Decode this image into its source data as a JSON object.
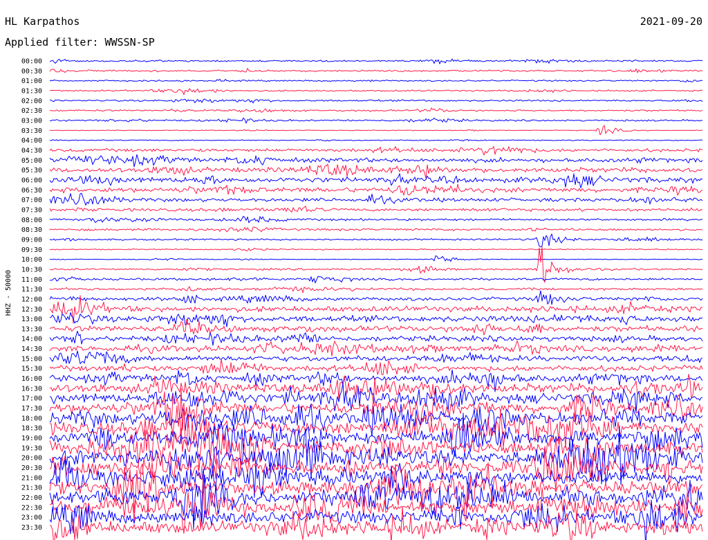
{
  "header": {
    "station": "HL Karpathos",
    "date": "2021-09-20",
    "filter": "Applied filter: WWSSN-SP"
  },
  "chart_data": {
    "type": "helicorder",
    "ylabel": "HHZ - 50000",
    "colors": [
      "#0000ff",
      "#ff1a4a"
    ],
    "row_labels": [
      "00:00",
      "00:30",
      "01:00",
      "01:30",
      "02:00",
      "02:30",
      "03:00",
      "03:30",
      "04:00",
      "04:30",
      "05:00",
      "05:30",
      "06:00",
      "06:30",
      "07:00",
      "07:30",
      "08:00",
      "08:30",
      "09:00",
      "09:30",
      "10:00",
      "10:30",
      "11:00",
      "11:30",
      "12:00",
      "12:30",
      "13:00",
      "13:30",
      "14:00",
      "14:30",
      "15:00",
      "15:30",
      "16:00",
      "16:30",
      "17:00",
      "17:30",
      "18:00",
      "18:30",
      "19:00",
      "19:30",
      "20:00",
      "20:30",
      "21:00",
      "21:30",
      "22:00",
      "22:30",
      "23:00",
      "23:30"
    ],
    "relative_noise_level": [
      0.3,
      0.3,
      0.26,
      0.26,
      0.3,
      0.3,
      0.3,
      0.12,
      0.18,
      0.55,
      0.75,
      0.85,
      0.95,
      0.85,
      0.65,
      0.5,
      0.4,
      0.4,
      0.3,
      0.2,
      0.14,
      0.32,
      0.38,
      0.4,
      0.6,
      0.95,
      1.05,
      1.0,
      0.95,
      1.0,
      0.95,
      1.0,
      1.3,
      1.6,
      1.7,
      1.9,
      2.1,
      2.2,
      2.2,
      2.4,
      2.4,
      2.4,
      2.3,
      2.3,
      2.4,
      2.4,
      2.2,
      2.1
    ],
    "notable_events": [
      {
        "row": "03:30",
        "position": 0.84,
        "strength": 2.5
      },
      {
        "row": "07:00",
        "position": 0.49,
        "strength": 3
      },
      {
        "row": "08:00",
        "position": 0.06,
        "strength": 2
      },
      {
        "row": "09:00",
        "position": 0.75,
        "strength": 4
      },
      {
        "row": "10:00",
        "position": 0.59,
        "strength": 2
      },
      {
        "row": "10:30",
        "position": 0.75,
        "strength": 9
      },
      {
        "row": "11:00",
        "position": 0.4,
        "strength": 2
      },
      {
        "row": "12:00",
        "position": 0.75,
        "strength": 4
      }
    ]
  }
}
